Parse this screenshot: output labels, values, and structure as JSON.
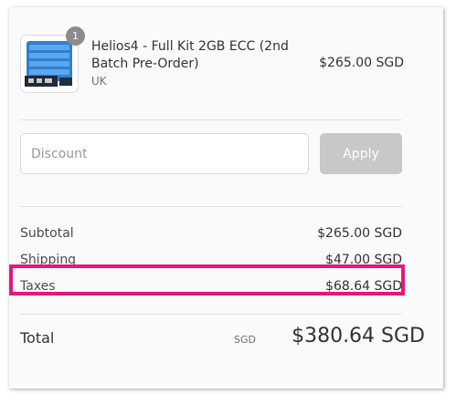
{
  "line_item": {
    "quantity": "1",
    "title": "Helios4 - Full Kit 2GB ECC (2nd Batch Pre-Order)",
    "variant": "UK",
    "price": "$265.00 SGD",
    "image_icon": "product-board-image"
  },
  "discount": {
    "placeholder": "Discount",
    "value": "",
    "apply_label": "Apply"
  },
  "summary": {
    "subtotal_label": "Subtotal",
    "subtotal_value": "$265.00 SGD",
    "shipping_label": "Shipping",
    "shipping_value": "$47.00 SGD",
    "taxes_label": "Taxes",
    "taxes_value": "$68.64 SGD"
  },
  "total": {
    "label": "Total",
    "currency": "SGD",
    "amount": "$380.64 SGD"
  },
  "colors": {
    "highlight": "#e2197a",
    "button_disabled": "#c8c8c8",
    "badge": "#8c8c8c"
  }
}
